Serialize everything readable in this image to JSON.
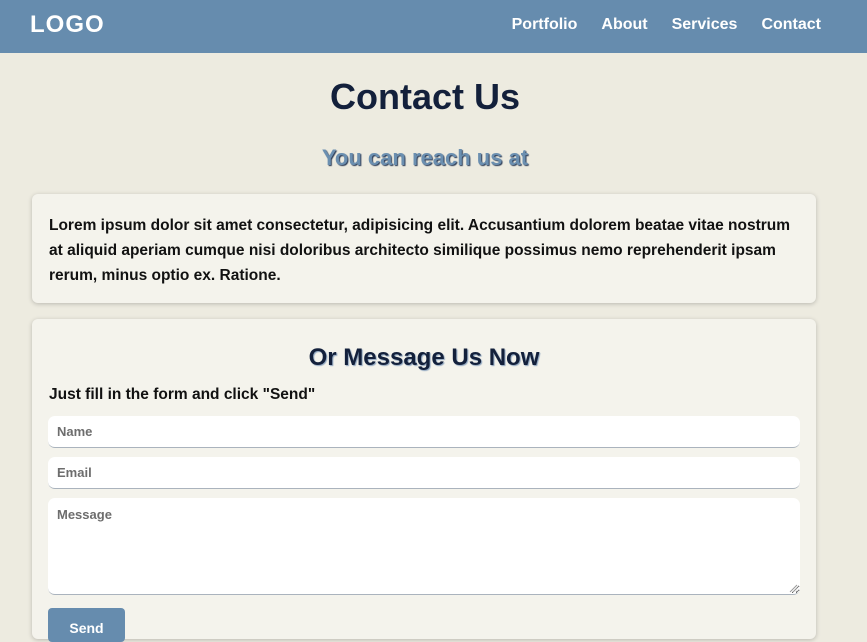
{
  "header": {
    "logo": "LOGO",
    "nav": [
      {
        "label": "Portfolio"
      },
      {
        "label": "About"
      },
      {
        "label": "Services"
      },
      {
        "label": "Contact"
      }
    ]
  },
  "main": {
    "title": "Contact Us",
    "subtitle": "You can reach us at",
    "info_text": "Lorem ipsum dolor sit amet consectetur, adipisicing elit. Accusantium dolorem beatae vitae nostrum at aliquid aperiam cumque nisi doloribus architecto similique possimus nemo reprehenderit ipsam rerum, minus optio ex. Ratione."
  },
  "form": {
    "title": "Or Message Us Now",
    "instruction": "Just fill in the form and click \"Send\"",
    "name_placeholder": "Name",
    "email_placeholder": "Email",
    "message_placeholder": "Message",
    "send_label": "Send"
  },
  "colors": {
    "navbar": "#668cae",
    "page_background": "#edebe0",
    "card_background": "#f4f3ec",
    "title_text": "#13203b",
    "subtitle_text": "#6b8fb0"
  }
}
